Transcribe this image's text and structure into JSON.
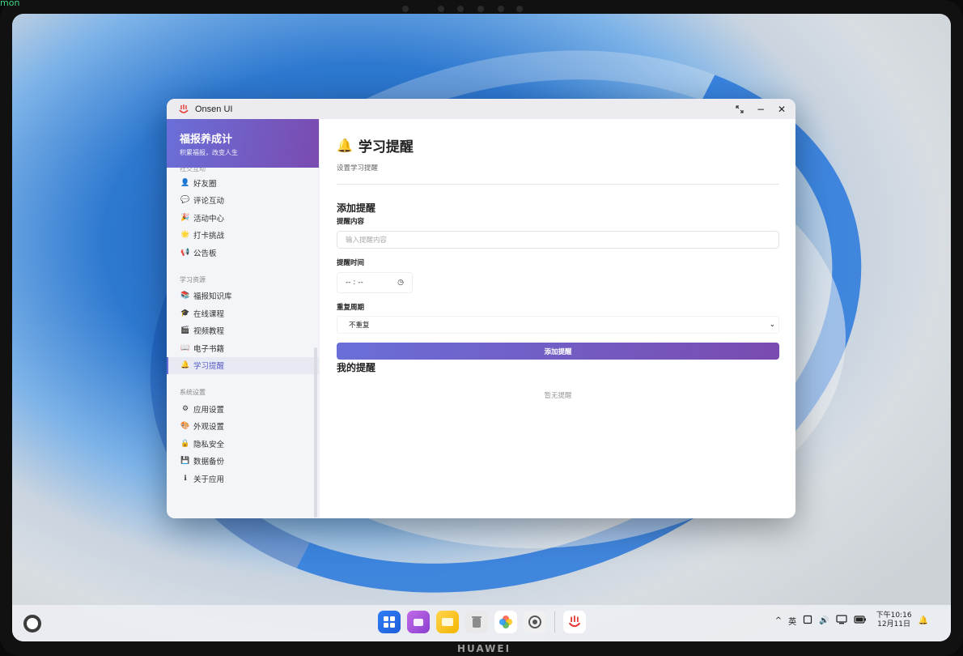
{
  "device": {
    "brand": "HUAWEI",
    "edge_text_left": "mon"
  },
  "window": {
    "app_title": "Onsen UI",
    "app_icon_glyph": "♨",
    "controls": {
      "restore_icon": "restore-icon",
      "minimize_label": "−",
      "close_label": "✕"
    }
  },
  "sidebar": {
    "title": "福报养成计",
    "subtitle": "积累福报，改变人生",
    "cut_section_label": "社交互动",
    "social_items": [
      {
        "icon": "👤",
        "label": "好友圈"
      },
      {
        "icon": "💬",
        "label": "评论互动"
      },
      {
        "icon": "🎉",
        "label": "活动中心"
      },
      {
        "icon": "🌟",
        "label": "打卡挑战"
      },
      {
        "icon": "📢",
        "label": "公告板"
      }
    ],
    "learning_section": "学习资源",
    "learning_items": [
      {
        "icon": "📚",
        "label": "福报知识库"
      },
      {
        "icon": "🎓",
        "label": "在线课程"
      },
      {
        "icon": "🎬",
        "label": "视频教程"
      },
      {
        "icon": "📖",
        "label": "电子书籍"
      },
      {
        "icon": "🔔",
        "label": "学习提醒"
      }
    ],
    "settings_section": "系统设置",
    "settings_items": [
      {
        "icon": "⚙",
        "label": "应用设置"
      },
      {
        "icon": "🎨",
        "label": "外观设置"
      },
      {
        "icon": "🔒",
        "label": "隐私安全"
      },
      {
        "icon": "💾",
        "label": "数据备份"
      },
      {
        "icon": "ℹ",
        "label": "关于应用"
      }
    ]
  },
  "main": {
    "title_icon": "🔔",
    "title": "学习提醒",
    "subtitle": "设置学习提醒",
    "add_section": "添加提醒",
    "content_label": "提醒内容",
    "content_placeholder": "输入提醒内容",
    "time_label": "提醒时间",
    "time_value": "-- : --",
    "time_icon": "◷",
    "repeat_label": "重复周期",
    "repeat_value": "不重复",
    "repeat_arrow": "⌄",
    "add_button": "添加提醒",
    "my_section": "我的提醒",
    "empty_text": "暂无提醒"
  },
  "taskbar": {
    "tray_ime": "英",
    "tray_chevron": "^",
    "tray_volume": "🔊",
    "tray_battery": "▭",
    "time": "下午10:16",
    "date": "12月11日",
    "notify_icon": "🔔"
  },
  "colors": {
    "accent_start": "#6a6fd8",
    "accent_end": "#7a4bb0",
    "app_icon_red": "#e53935"
  }
}
